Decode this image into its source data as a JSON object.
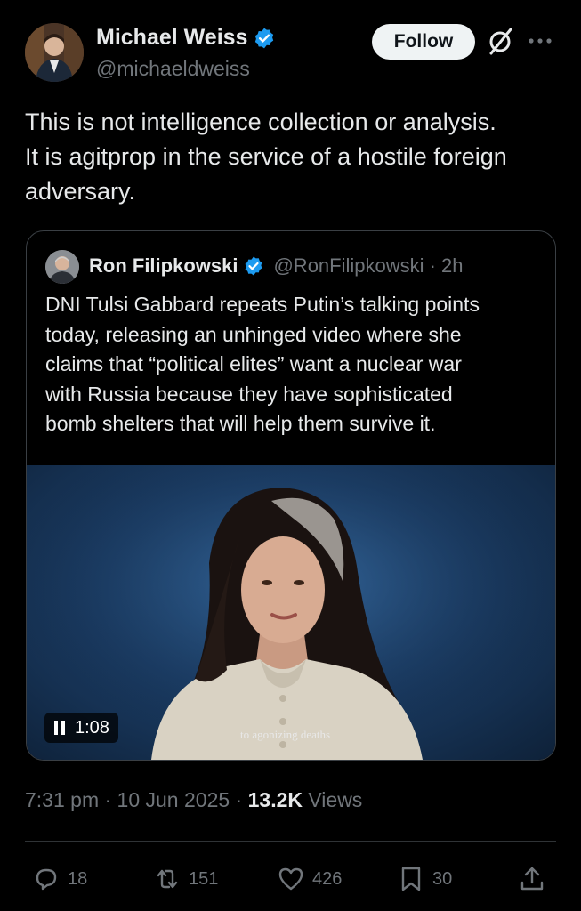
{
  "author": {
    "name": "Michael Weiss",
    "handle": "@michaeldweiss"
  },
  "header": {
    "follow_label": "Follow"
  },
  "tweet": {
    "text": "This is not intelligence collection or analysis.\nIt is agitprop in the service of a hostile foreign\nadversary."
  },
  "quote": {
    "name": "Ron Filipkowski",
    "handle": "@RonFilipkowski · 2h",
    "text": "DNI Tulsi Gabbard repeats Putin’s talking points\ntoday, releasing an unhinged video where she\nclaims that “political elites” want a nuclear war\nwith Russia because they have sophisticated\nbomb shelters that will help them survive it.",
    "video": {
      "duration": "1:08",
      "caption": "to agonizing deaths"
    }
  },
  "meta": {
    "time_date": "7:31 pm · 10 Jun 2025 · ",
    "views_count": "13.2K",
    "views_label": " Views"
  },
  "actions": {
    "replies": "18",
    "reposts": "151",
    "likes": "426",
    "bookmarks": "30"
  },
  "colors": {
    "verified": "#1d9bf0",
    "background": "#000000",
    "secondary_text": "#71767b"
  },
  "icons": [
    "verified-badge-icon",
    "grok-icon",
    "more-icon",
    "pause-icon",
    "reply-icon",
    "repost-icon",
    "like-icon",
    "bookmark-icon",
    "share-icon"
  ]
}
